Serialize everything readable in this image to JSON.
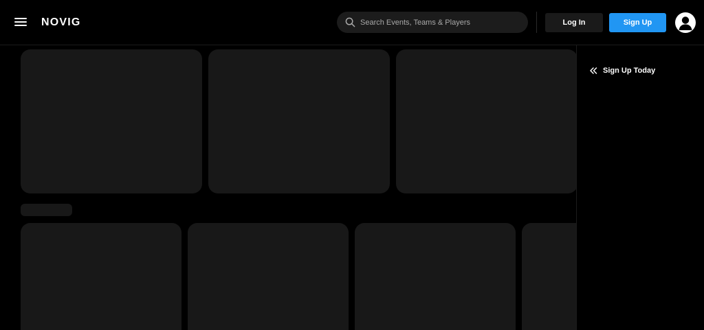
{
  "header": {
    "logo": "NOVIG",
    "search": {
      "placeholder": "Search Events, Teams & Players"
    },
    "login_label": "Log In",
    "signup_label": "Sign Up"
  },
  "side_panel": {
    "title": "Sign Up Today"
  },
  "icons": {
    "menu": "hamburger-menu-icon",
    "search": "search-icon",
    "avatar": "user-avatar-icon",
    "collapse": "double-chevron-left-icon"
  },
  "colors": {
    "background": "#000000",
    "skeleton": "#181818",
    "search_bg": "#1c1c1c",
    "login_bg": "#1a1a1a",
    "signup_bg": "#2196f3",
    "text": "#ffffff",
    "placeholder": "#a9a9a9"
  }
}
